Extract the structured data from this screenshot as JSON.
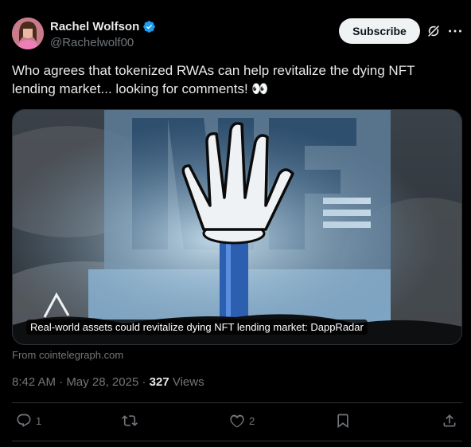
{
  "author": {
    "name": "Rachel Wolfson",
    "handle": "@Rachelwolf00",
    "verified": true
  },
  "header": {
    "subscribe_label": "Subscribe"
  },
  "tweet": {
    "text": "Who agrees that tokenized RWAs can help revitalize the dying NFT lending market... looking for comments! 👀"
  },
  "card": {
    "image_text": "NFT",
    "caption": "Real-world assets could revitalize dying NFT lending market: DappRadar",
    "source": "From cointelegraph.com"
  },
  "meta": {
    "time": "8:42 AM",
    "separator": "·",
    "date": "May 28, 2025",
    "views_count": "327",
    "views_label": "Views"
  },
  "actions": {
    "replies": "1",
    "reposts": "",
    "likes": "2"
  },
  "colors": {
    "background": "#000000",
    "text_primary": "#e7e9ea",
    "text_secondary": "#71767b",
    "verified_blue": "#1d9bf0",
    "divider": "#2f3336",
    "subscribe_bg": "#eff3f4"
  }
}
